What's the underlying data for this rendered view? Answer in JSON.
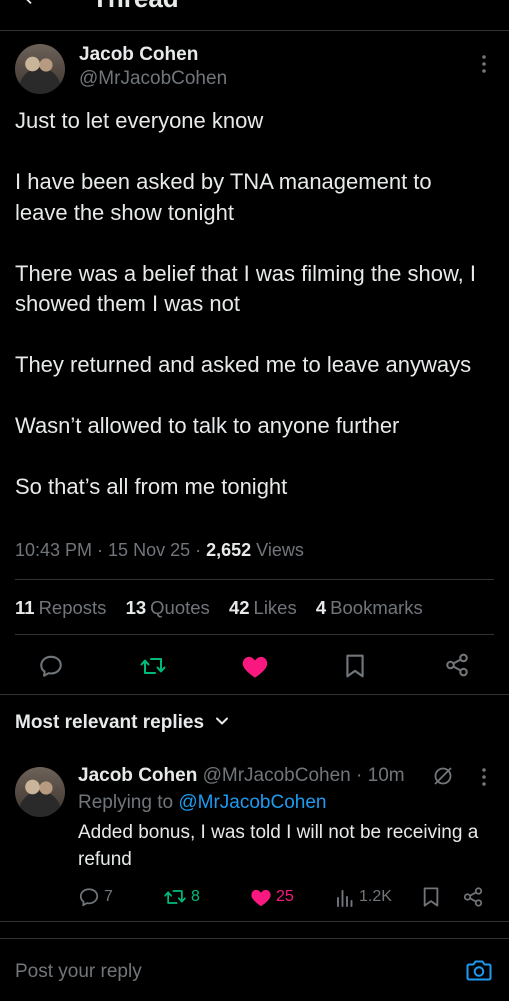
{
  "header": {
    "back_icon": "arrow-left-icon",
    "title": "Thread"
  },
  "tweet": {
    "author": {
      "name": "Jacob Cohen",
      "handle": "@MrJacobCohen"
    },
    "text": "Just to let everyone know\n\nI have been asked by TNA management to leave the show tonight\n\nThere was a belief that I was filming the show, I showed them I was not\n\nThey returned and asked me to leave anyways\n\nWasn’t allowed to talk to anyone further\n\nSo that’s all from me tonight",
    "time": "10:43 PM",
    "date": "15 Nov 25",
    "views_count": "2,652",
    "views_label": "Views",
    "stats": {
      "reposts_count": "11",
      "reposts_label": "Reposts",
      "quotes_count": "13",
      "quotes_label": "Quotes",
      "likes_count": "42",
      "likes_label": "Likes",
      "bookmarks_count": "4",
      "bookmarks_label": "Bookmarks"
    },
    "colors": {
      "repost": "#00ba7c",
      "like": "#f91880",
      "muted": "#71767b",
      "link": "#1d9bf0"
    }
  },
  "replies": {
    "title": "Most relevant replies",
    "items": [
      {
        "name": "Jacob Cohen",
        "handle": "@MrJacobCohen",
        "age": "10m",
        "replying_prefix": "Replying to",
        "replying_to": "@MrJacobCohen",
        "text": "Added bonus, I was told I will not be receiving a refund",
        "replies": "7",
        "reposts": "8",
        "likes": "25",
        "views": "1.2K"
      }
    ]
  },
  "composer": {
    "placeholder": "Post your reply",
    "camera_icon": "camera-icon"
  }
}
